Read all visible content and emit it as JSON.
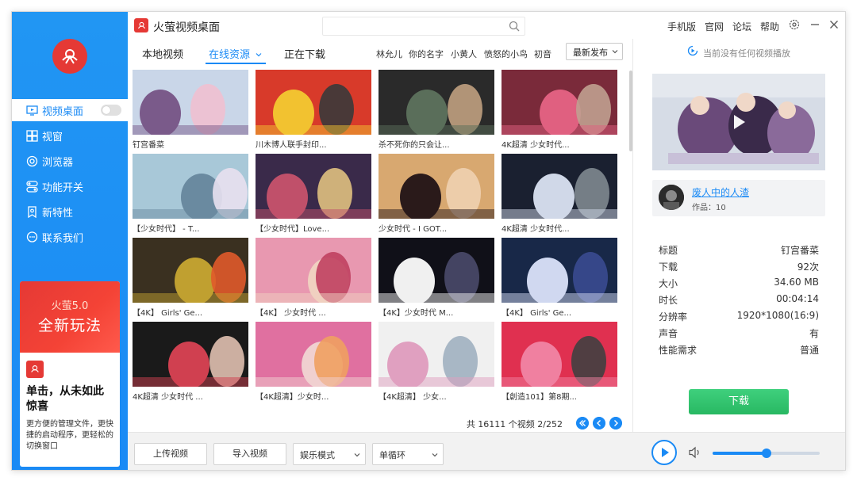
{
  "app": {
    "title": "火萤视频桌面",
    "accent": "#1a8af5",
    "brand_red": "#e53935"
  },
  "titlebar": {
    "links": [
      "手机版",
      "官网",
      "论坛",
      "帮助"
    ],
    "icons": [
      "gear-icon",
      "minimize-icon",
      "close-icon"
    ]
  },
  "sidebar": {
    "items": [
      {
        "label": "视频桌面",
        "icon": "desktop-icon",
        "active": true,
        "toggle": false
      },
      {
        "label": "视窗",
        "icon": "window-icon"
      },
      {
        "label": "浏览器",
        "icon": "browser-icon"
      },
      {
        "label": "功能开关",
        "icon": "switch-icon"
      },
      {
        "label": "新特性",
        "icon": "feature-icon"
      },
      {
        "label": "联系我们",
        "icon": "chat-icon"
      }
    ],
    "promo": {
      "version": "火萤5.0",
      "headline": "全新玩法",
      "title": "单击，从未如此惊喜",
      "desc": "更方便的管理文件，更快捷的启动程序，更轻松的切换窗口"
    }
  },
  "tabs": {
    "items": [
      "本地视频",
      "在线资源",
      "正在下载"
    ],
    "active": 1,
    "tags": [
      "林允儿",
      "你的名字",
      "小黄人",
      "愤怒的小鸟",
      "初音"
    ],
    "sort": "最新发布"
  },
  "grid": {
    "items": [
      {
        "caption": "钉宫番菜",
        "palette": [
          "#c9d6e8",
          "#7a5a8a",
          "#f0c0d0"
        ]
      },
      {
        "caption": "川木博人联手封印...",
        "palette": [
          "#d83a2a",
          "#f2c230",
          "#3a3a3a"
        ]
      },
      {
        "caption": "杀不死你的只会让...",
        "palette": [
          "#2a2a2a",
          "#5a6e5a",
          "#c0a080"
        ]
      },
      {
        "caption": "4K超清 少女时代...",
        "palette": [
          "#7a2a3a",
          "#e06080",
          "#c0a090"
        ]
      },
      {
        "caption": "【少女时代】 - T...",
        "palette": [
          "#a8c8d8",
          "#6a8aa0",
          "#e8e0f0"
        ]
      },
      {
        "caption": "【少女时代】Love...",
        "palette": [
          "#3a2a4a",
          "#c0506a",
          "#e0c080"
        ]
      },
      {
        "caption": "少女时代 - I GOT...",
        "palette": [
          "#d8a870",
          "#2a1a1a",
          "#f0d0b0"
        ]
      },
      {
        "caption": "4K超清 少女时代...",
        "palette": [
          "#1a2030",
          "#d0d8e8",
          "#808890"
        ]
      },
      {
        "caption": "【4K】 Girls' Ge...",
        "palette": [
          "#3a3020",
          "#c0a030",
          "#e05a2a"
        ]
      },
      {
        "caption": "【4K】 少女时代 ...",
        "palette": [
          "#e898b0",
          "#f0d0c0",
          "#c04060"
        ]
      },
      {
        "caption": "【4K】少女时代 M...",
        "palette": [
          "#101018",
          "#f0f0f0",
          "#4a4a6a"
        ]
      },
      {
        "caption": "【4K】 Girls' Ge...",
        "palette": [
          "#182848",
          "#d0d8f0",
          "#3a4a90"
        ]
      },
      {
        "caption": "4K超清 少女时代 ...",
        "palette": [
          "#1a1a1a",
          "#d04050",
          "#e0c0b0"
        ]
      },
      {
        "caption": "【4K超清】少女时...",
        "palette": [
          "#e070a0",
          "#f0d0d0",
          "#f0a060"
        ]
      },
      {
        "caption": "【4K超清】 少女...",
        "palette": [
          "#f0f0f0",
          "#e0a0c0",
          "#a0b0c0"
        ]
      },
      {
        "caption": "【創造101】第8期...",
        "palette": [
          "#e03050",
          "#f080a0",
          "#404040"
        ]
      }
    ]
  },
  "pagination": {
    "text": "共 16111 个视频  2/252",
    "buttons": [
      "prev-icon",
      "previous-page-icon",
      "next-page-icon"
    ]
  },
  "right": {
    "now_playing": "当前没有任何视频播放",
    "author_name": "废人中的人渣",
    "author_works": "作品：10",
    "meta": [
      {
        "k": "标题",
        "v": "钉宫番菜"
      },
      {
        "k": "下载",
        "v": "92次"
      },
      {
        "k": "大小",
        "v": "34.60 MB"
      },
      {
        "k": "时长",
        "v": "00:04:14"
      },
      {
        "k": "分辨率",
        "v": "1920*1080(16:9)"
      },
      {
        "k": "声音",
        "v": "有"
      },
      {
        "k": "性能需求",
        "v": "普通"
      }
    ],
    "download": "下载"
  },
  "bottombar": {
    "upload": "上传视频",
    "import": "导入视频",
    "mode": "娱乐模式",
    "loop": "单循环",
    "volume": 0.5
  }
}
